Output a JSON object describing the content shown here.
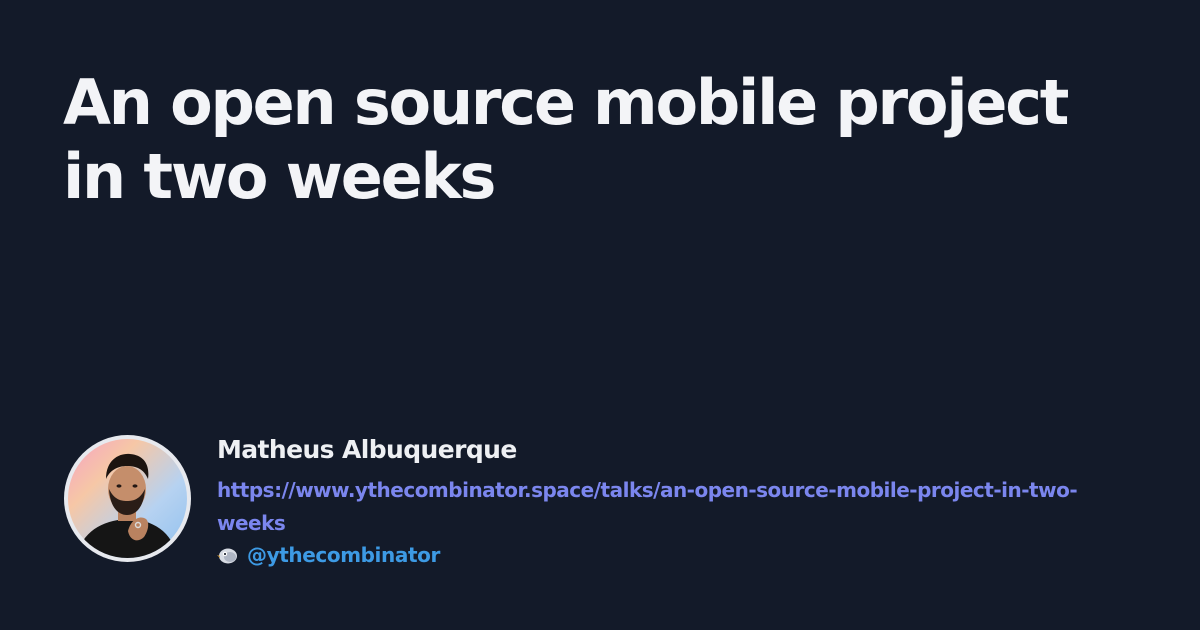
{
  "talk": {
    "title": "An open source mobile project in two weeks"
  },
  "author": {
    "name": "Matheus Albuquerque",
    "url": "https://www.ythecombinator.space/talks/an-open-source-mobile-project-in-two-weeks",
    "handle": "@ythecombinator",
    "handle_icon": "bird-icon",
    "avatar_icon": "avatar-photo"
  },
  "colors": {
    "background": "#131a29",
    "title": "#f3f4f7",
    "name": "#eef0f3",
    "url": "#7b86ee",
    "handle": "#3d9ae4"
  }
}
